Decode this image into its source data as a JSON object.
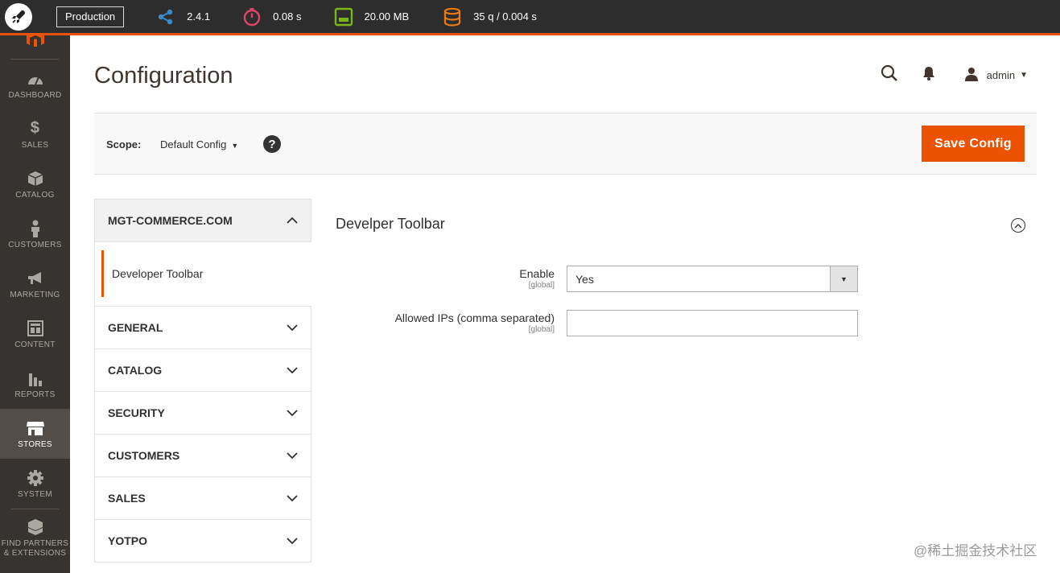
{
  "devbar": {
    "environment": "Production",
    "metrics": [
      {
        "icon": "share-icon",
        "value": "2.4.1",
        "color": "#3a8bc9"
      },
      {
        "icon": "stopwatch-icon",
        "value": "0.08 s",
        "color": "#e0436b"
      },
      {
        "icon": "memory-icon",
        "value": "20.00 MB",
        "color": "#7cb518"
      },
      {
        "icon": "database-icon",
        "value": "35 q / 0.004 s",
        "color": "#eb7a15"
      }
    ],
    "accent": "#eb5202"
  },
  "sidebar": {
    "items": [
      {
        "label": "DASHBOARD",
        "icon": "dashboard-icon"
      },
      {
        "label": "SALES",
        "icon": "dollar-icon"
      },
      {
        "label": "CATALOG",
        "icon": "box-icon"
      },
      {
        "label": "CUSTOMERS",
        "icon": "person-icon"
      },
      {
        "label": "MARKETING",
        "icon": "megaphone-icon"
      },
      {
        "label": "CONTENT",
        "icon": "layout-icon"
      },
      {
        "label": "REPORTS",
        "icon": "bar-chart-icon"
      },
      {
        "label": "STORES",
        "icon": "store-icon",
        "active": true
      },
      {
        "label": "SYSTEM",
        "icon": "gear-icon"
      }
    ],
    "partners_line1": "FIND PARTNERS",
    "partners_line2": "& EXTENSIONS"
  },
  "header": {
    "title": "Configuration",
    "user": "admin"
  },
  "scope": {
    "label": "Scope:",
    "value": "Default Config",
    "help": "?"
  },
  "actions": {
    "save_label": "Save Config"
  },
  "tabs": {
    "open_group": "MGT-COMMERCE.COM",
    "active_item": "Developer Toolbar",
    "groups": [
      "GENERAL",
      "CATALOG",
      "SECURITY",
      "CUSTOMERS",
      "SALES",
      "YOTPO"
    ]
  },
  "section": {
    "title": "Develper Toolbar",
    "fields": [
      {
        "label": "Enable",
        "scope": "[global]",
        "value": "Yes"
      },
      {
        "label": "Allowed IPs (comma separated)",
        "scope": "[global]",
        "value": ""
      }
    ]
  },
  "watermark": "@稀土掘金技术社区"
}
